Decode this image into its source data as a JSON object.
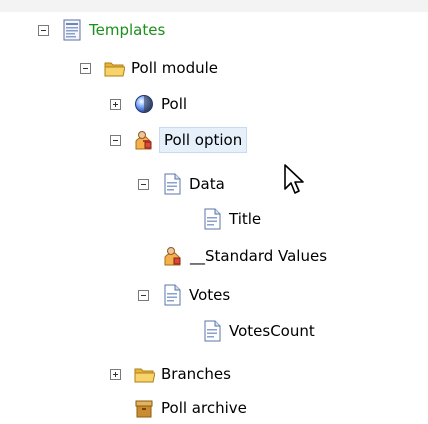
{
  "tree": {
    "items": [
      {
        "label": "Templates",
        "icon": "template-icon",
        "toggle": "minus",
        "color": "#1a8f1a"
      },
      {
        "label": "Poll module",
        "icon": "folder-icon",
        "toggle": "minus"
      },
      {
        "label": "Poll",
        "icon": "globe-icon",
        "toggle": "plus"
      },
      {
        "label": "Poll option",
        "icon": "person-icon",
        "toggle": "minus",
        "selected": true
      },
      {
        "label": "Data",
        "icon": "document-icon",
        "toggle": "minus"
      },
      {
        "label": "Title",
        "icon": "document-icon"
      },
      {
        "label": "__Standard Values",
        "icon": "person-icon"
      },
      {
        "label": "Votes",
        "icon": "document-icon",
        "toggle": "minus"
      },
      {
        "label": "VotesCount",
        "icon": "document-icon"
      },
      {
        "label": "Branches",
        "icon": "folder-icon",
        "toggle": "plus"
      },
      {
        "label": "Poll archive",
        "icon": "archive-box-icon"
      }
    ]
  }
}
